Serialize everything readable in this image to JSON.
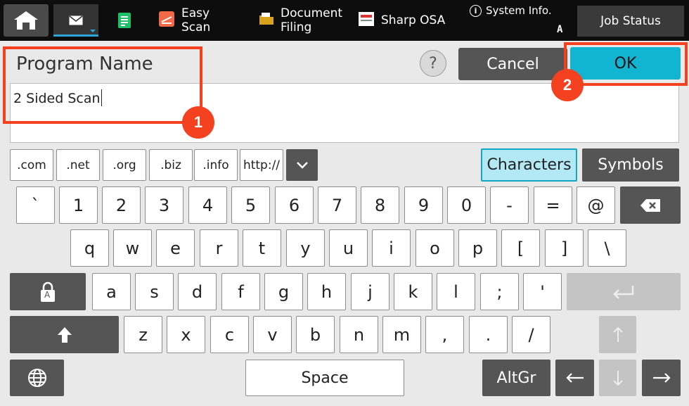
{
  "topbar": {
    "easy_scan": "Easy\nScan",
    "document_filing": "Document\nFiling",
    "sharp_osa": "Sharp OSA",
    "system_info": "System Info.",
    "system_info_mark": "A",
    "job_status": "Job Status"
  },
  "header": {
    "program_name_label": "Program Name",
    "help": "?",
    "cancel": "Cancel",
    "ok": "OK"
  },
  "input": {
    "value": "2 Sided Scan"
  },
  "callouts": {
    "one": "1",
    "two": "2"
  },
  "keyboard": {
    "domains": [
      ".com",
      ".net",
      ".org",
      ".biz",
      ".info",
      "http://"
    ],
    "characters_tab": "Characters",
    "symbols_tab": "Symbols",
    "row1": [
      "`",
      "1",
      "2",
      "3",
      "4",
      "5",
      "6",
      "7",
      "8",
      "9",
      "0",
      "-",
      "=",
      "@"
    ],
    "row2": [
      "q",
      "w",
      "e",
      "r",
      "t",
      "y",
      "u",
      "i",
      "o",
      "p",
      "[",
      "]",
      "\\"
    ],
    "row3": [
      "a",
      "s",
      "d",
      "f",
      "g",
      "h",
      "j",
      "k",
      "l",
      ";",
      "'"
    ],
    "row4": [
      "z",
      "x",
      "c",
      "v",
      "b",
      "n",
      "m",
      ",",
      ".",
      "/"
    ],
    "space": "Space",
    "altgr": "AltGr",
    "caps_lock_glyph": "A"
  },
  "colors": {
    "accent": "#12b5d1",
    "callout": "#f4411f",
    "dark_key": "#555555"
  }
}
